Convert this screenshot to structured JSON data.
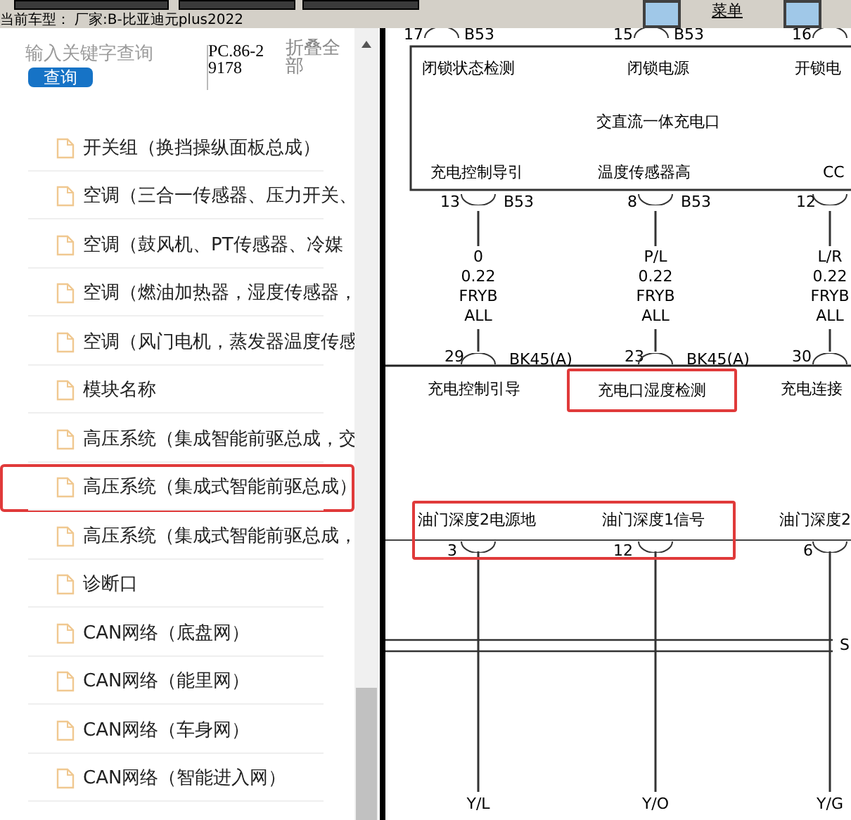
{
  "toolbar": {
    "menu_link": "菜单"
  },
  "status": {
    "vehicle_label": "当前车型：",
    "vehicle_value": "厂家:B-比亚迪元plus2022"
  },
  "search": {
    "placeholder": "输入关键字查询",
    "button": "查询",
    "code": "PC.86-29178",
    "collapse": "折叠全部"
  },
  "tree_items": [
    {
      "label": "开关组（换挡操纵面板总成）",
      "highlighted": false
    },
    {
      "label": "空调（三合一传感器、压力开关、",
      "highlighted": false
    },
    {
      "label": "空调（鼓风机、PT传感器、冷媒",
      "highlighted": false
    },
    {
      "label": "空调（燃油加热器，湿度传感器，",
      "highlighted": false
    },
    {
      "label": "空调（风门电机，蒸发器温度传感",
      "highlighted": false
    },
    {
      "label": "模块名称",
      "highlighted": false
    },
    {
      "label": "高压系统（集成智能前驱总成，交",
      "highlighted": false
    },
    {
      "label": "高压系统（集成式智能前驱总成）",
      "highlighted": true
    },
    {
      "label": "高压系统（集成式智能前驱总成，",
      "highlighted": false
    },
    {
      "label": "诊断口",
      "highlighted": false
    },
    {
      "label": "CAN网络（底盘网）",
      "highlighted": false
    },
    {
      "label": "CAN网络（能里网）",
      "highlighted": false
    },
    {
      "label": "CAN网络（车身网）",
      "highlighted": false
    },
    {
      "label": "CAN网络（智能进入网）",
      "highlighted": false
    }
  ],
  "diagram": {
    "top_pins": [
      {
        "number": "17",
        "connector": "B53"
      },
      {
        "number": "15",
        "connector": "B53"
      },
      {
        "number": "16"
      }
    ],
    "module": {
      "top_labels": [
        "闭锁状态检测",
        "闭锁电源",
        "开锁电"
      ],
      "title": "交直流一体充电口",
      "bottom_labels": [
        "充电控制导引",
        "温度传感器高",
        "CC"
      ]
    },
    "bottom_pins": [
      {
        "number": "13",
        "connector": "B53"
      },
      {
        "number": "8",
        "connector": "B53"
      },
      {
        "number": "12"
      }
    ],
    "wires": [
      {
        "code": "0",
        "size": "0.22",
        "type": "FRYB",
        "option": "ALL"
      },
      {
        "code": "P/L",
        "size": "0.22",
        "type": "FRYB",
        "option": "ALL"
      },
      {
        "code": "L/R",
        "size": "0.22",
        "type": "FRYB",
        "option": "ALL"
      }
    ],
    "connector_pins": [
      {
        "number": "29",
        "connector": "BK45(A)"
      },
      {
        "number": "23",
        "connector": "BK45(A)"
      },
      {
        "number": "30"
      }
    ],
    "signal_labels": [
      {
        "text": "充电控制引导",
        "highlighted": false
      },
      {
        "text": "充电口湿度检测",
        "highlighted": true
      },
      {
        "text": "充电连接",
        "highlighted": false
      }
    ],
    "lower_group": {
      "highlighted": true,
      "labels": [
        "油门深度2电源地",
        "油门深度1信号"
      ],
      "pins": [
        "3",
        "12"
      ]
    },
    "lower_extra": {
      "label": "油门深度2",
      "pin": "6"
    },
    "bus_label": "S",
    "lower_wires": [
      "Y/L",
      "Y/O",
      "Y/G"
    ]
  }
}
